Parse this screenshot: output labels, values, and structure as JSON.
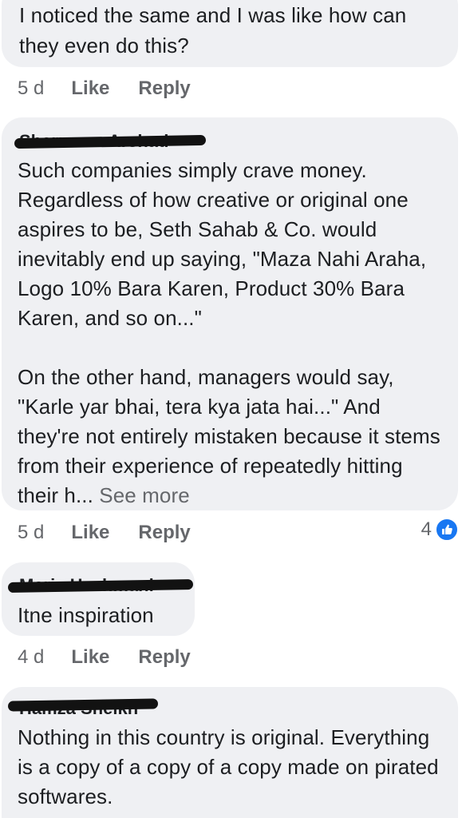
{
  "comments": [
    {
      "author": "",
      "text": "I noticed the same and I was like how can they even do this?",
      "time": "5 d",
      "like_label": "Like",
      "reply_label": "Reply"
    },
    {
      "author": "Sharmeen Arshad",
      "text": "Such companies simply crave money. Regardless of how creative or original one aspires to be, Seth Sahab & Co. would inevitably end up saying, \"Maza Nahi Araha, Logo 10% Bara Karen, Product 30% Bara Karen, and so on...\"\n\nOn the other hand, managers would say, \"Karle yar bhai, tera kya jata hai...\" And they're not entirely mistaken because it stems from their experience of repeatedly hitting their h...",
      "see_more": "See more",
      "time": "5 d",
      "like_label": "Like",
      "reply_label": "Reply",
      "reaction_count": "4",
      "reaction_icon": "like-thumb-icon"
    },
    {
      "author": "Maria Hashmani",
      "text": "Itne inspiration",
      "time": "4 d",
      "like_label": "Like",
      "reply_label": "Reply"
    },
    {
      "author": "Hamza Sheikh",
      "text": "Nothing in this country is original. Everything is a copy of a copy of a copy made on pirated softwares."
    }
  ],
  "colors": {
    "bubble": "#eff0f3",
    "text": "#1c1e21",
    "meta": "#65676b",
    "like_blue": "#1877f2"
  }
}
